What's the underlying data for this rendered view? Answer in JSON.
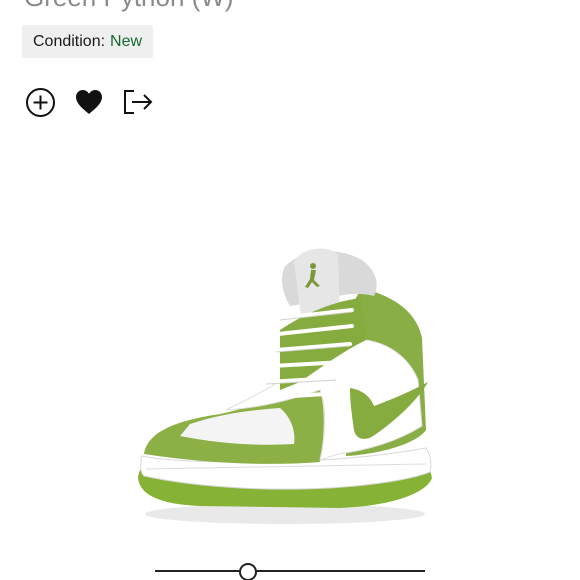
{
  "product": {
    "title": "Green Python (W)"
  },
  "condition": {
    "label": "Condition:",
    "value": "New",
    "value_color": "#136b2e"
  },
  "actions": [
    {
      "icon": "plus-circle-icon",
      "label": "Add to portfolio"
    },
    {
      "icon": "heart-icon",
      "label": "Favorite"
    },
    {
      "icon": "share-icon",
      "label": "Share"
    }
  ],
  "image": {
    "subject": "Air Jordan 1 Mid sneaker, green python and white"
  },
  "viewer_slider": {
    "position": 0.34
  }
}
